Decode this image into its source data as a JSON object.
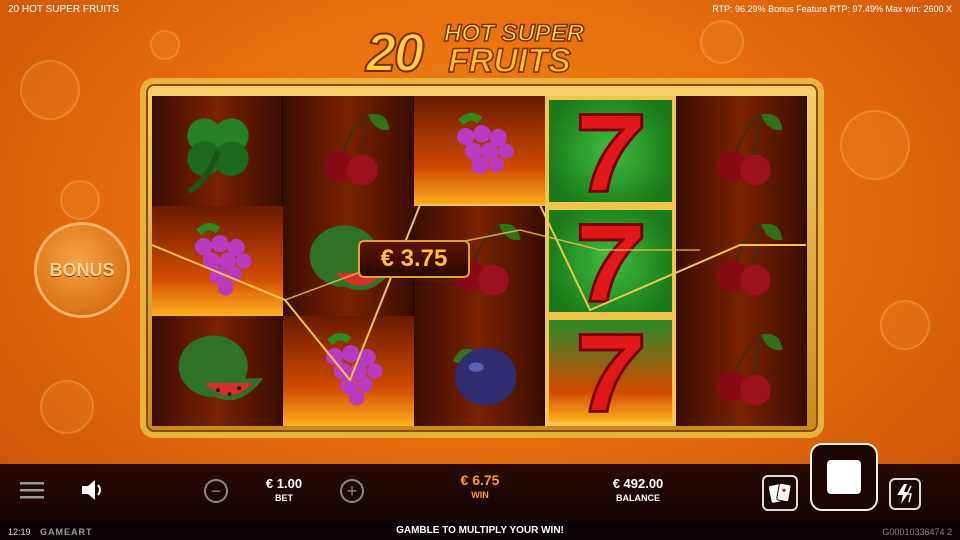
{
  "header": {
    "game_title": "20 HOT SUPER FRUITS",
    "rtp_info": "RTP: 96.29% Bonus Feature RTP: 97.49% Max win: 2600 X"
  },
  "logo": {
    "number": "20",
    "line1": "HOT SUPER",
    "line2": "FRUITS"
  },
  "bonus_button": {
    "label": "BONUS"
  },
  "reels": [
    [
      "clover",
      "grapes",
      "watermelon"
    ],
    [
      "cherries",
      "watermelon",
      "grapes"
    ],
    [
      "grapes",
      "cherries",
      "plum"
    ],
    [
      "seven",
      "seven",
      "seven"
    ],
    [
      "cherries",
      "cherries",
      "cherries"
    ]
  ],
  "win_popup": {
    "amount": "€ 3.75"
  },
  "controls": {
    "bet_value": "€ 1.00",
    "bet_label": "BET",
    "win_value": "€ 6.75",
    "win_label": "WIN",
    "balance_value": "€ 492.00",
    "balance_label": "BALANCE"
  },
  "footer": {
    "time": "12:19",
    "brand": "GAMEART",
    "message": "GAMBLE TO MULTIPLY YOUR WIN!",
    "game_id": "G00010336474 2"
  },
  "colors": {
    "accent_gold": "#e8b33a",
    "win_orange": "#ff9a2a",
    "background_orange": "#e8700c"
  },
  "icons": [
    "menu-icon",
    "sound-icon",
    "minus-icon",
    "plus-icon",
    "cards-icon",
    "stop-icon",
    "lightning-icon"
  ]
}
